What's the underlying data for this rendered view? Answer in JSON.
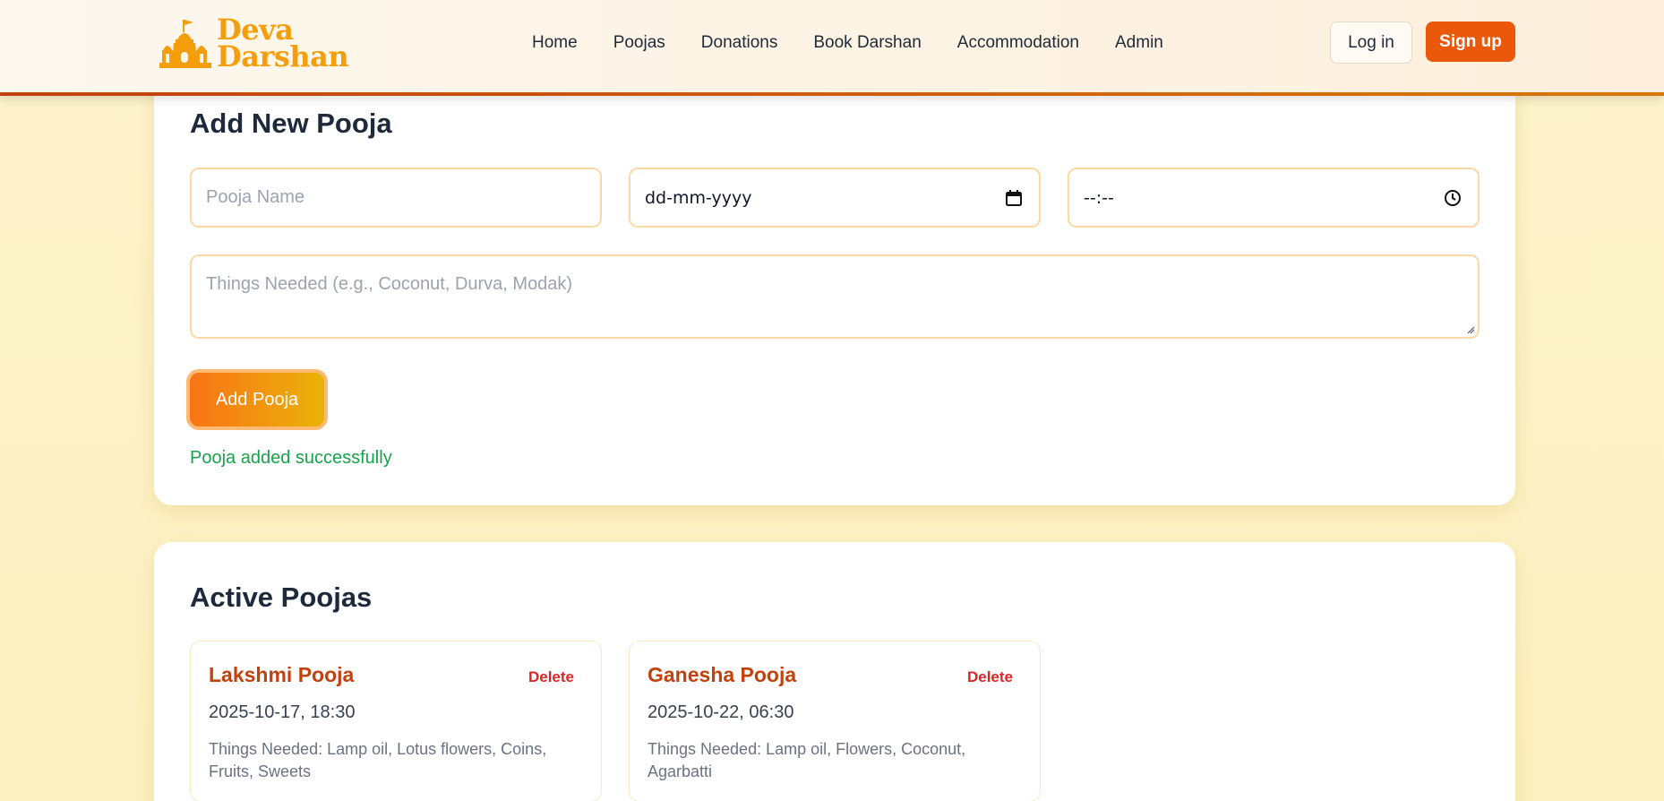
{
  "header": {
    "logo_line1": "Deva",
    "logo_line2": "Darshan",
    "nav": [
      "Home",
      "Poojas",
      "Donations",
      "Book Darshan",
      "Accommodation",
      "Admin"
    ],
    "login_label": "Log in",
    "signup_label": "Sign up"
  },
  "add_form": {
    "title": "Add New Pooja",
    "name_placeholder": "Pooja Name",
    "date_value": "dd-mm-yyyy",
    "time_value": "--:--",
    "things_placeholder": "Things Needed (e.g., Coconut, Durva, Modak)",
    "submit_label": "Add Pooja",
    "status_message": "Pooja added successfully"
  },
  "active": {
    "title": "Active Poojas",
    "items": [
      {
        "name": "Lakshmi Pooja",
        "delete_label": "Delete",
        "datetime": "2025-10-17, 18:30",
        "things": "Things Needed: Lamp oil, Lotus flowers, Coins, Fruits, Sweets"
      },
      {
        "name": "Ganesha Pooja",
        "delete_label": "Delete",
        "datetime": "2025-10-22, 06:30",
        "things": "Things Needed: Lamp oil, Flowers, Coconut, Agarbatti"
      }
    ]
  },
  "colors": {
    "accent": "#ea580c",
    "title_text": "#c2410c",
    "success": "#16a34a",
    "delete": "#dc2626",
    "background": "#fdf3cc"
  },
  "icons": {
    "logo": "temple-icon",
    "date": "calendar-icon",
    "time": "clock-icon"
  }
}
